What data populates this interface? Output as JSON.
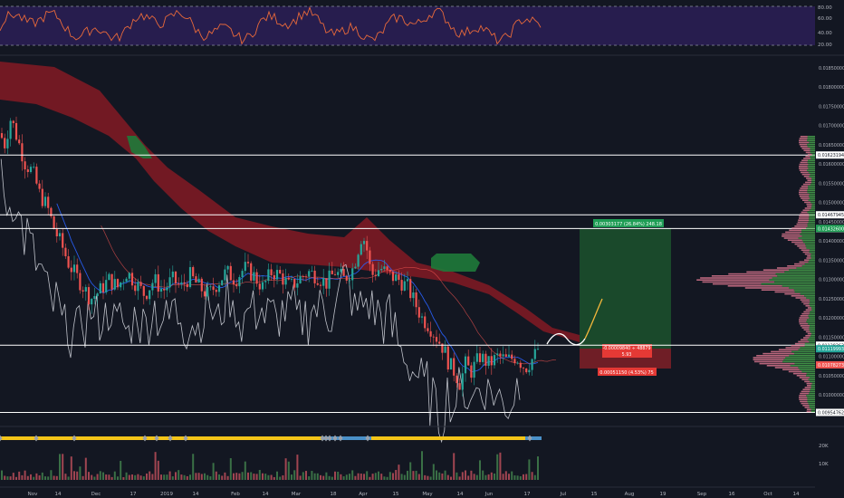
{
  "colors": {
    "background": "#131722",
    "grid": "#1e2230",
    "candle_up": "#26a69a",
    "candle_down": "#ef5350",
    "cloud_bear": "#8b1a24",
    "cloud_bull": "#1f7a3a",
    "lagging_line": "#d1d4dc",
    "base_line": "#2962ff",
    "rsi_line": "#e8693a",
    "rsi_band": "#2c1f56",
    "level_line": "#ffffff",
    "profile_up": "#4caf50",
    "profile_down": "#e37b93",
    "forecast_curve": "#ffffff",
    "forecast_arrow_up": "#f5b73b",
    "target_zone": "#1c4f2c",
    "stop_zone": "#7a1f27",
    "strip_yellow": "#f5c518",
    "strip_blue": "#4a90c8"
  },
  "rsi_panel": {
    "ticks": [
      "80.00",
      "60.00",
      "40.00",
      "20.00"
    ],
    "band_upper": 80,
    "band_lower": 20
  },
  "main_panel": {
    "y_ticks": [
      "0.01850000",
      "0.01800000",
      "0.01750000",
      "0.01700000",
      "0.01650000",
      "0.01600000",
      "0.01550000",
      "0.01500000",
      "0.01450000",
      "0.01400000",
      "0.01350000",
      "0.01300000",
      "0.01250000",
      "0.01200000",
      "0.01150000",
      "0.01100000",
      "0.01050000",
      "0.01000000"
    ],
    "levels": [
      {
        "label": "0.01623194",
        "value": 0.01623194
      },
      {
        "label": "0.01467945",
        "value": 0.01467945
      },
      {
        "label": "0.01432221",
        "value": 0.01432221
      },
      {
        "label": "0.01129421",
        "value": 0.01129421
      },
      {
        "label": "0.00954762",
        "value": 0.00954762
      }
    ],
    "price_tags": [
      {
        "label": "0.01432600",
        "value": 0.014326,
        "color": "#1f9d55"
      },
      {
        "label": "0.01128363",
        "value": 0.01128363,
        "color": "#ffffff"
      },
      {
        "label": "0.01119993",
        "value": 0.01119993,
        "color": "#26a69a"
      },
      {
        "label": "0.01078273",
        "value": 0.01078273,
        "color": "#ef5350"
      }
    ],
    "position_labels": {
      "target": "0.00303177 (26.84%) 248.18",
      "entry_line1": "-0.00009840 ÷ 48879",
      "entry_line2": "5.93",
      "stop": "0.00051150 (4.53%) 75"
    }
  },
  "volume_panel": {
    "ticks": [
      "20K",
      "10K"
    ]
  },
  "x_ticks": [
    "Nov",
    "14",
    "Dec",
    "17",
    "2019",
    "14",
    "Feb",
    "14",
    "Mar",
    "18",
    "Apr",
    "15",
    "May",
    "14",
    "Jun",
    "17",
    "Jul",
    "15",
    "Aug",
    "19",
    "Sep",
    "16",
    "Oct",
    "14"
  ],
  "chart_data": {
    "type": "candlestick",
    "symbol": "",
    "y_range": [
      0.0093,
      0.0188
    ],
    "rsi_range": [
      10,
      85
    ],
    "support_resistance": [
      0.01623194,
      0.01467945,
      0.01432221,
      0.01129421,
      0.00954762
    ],
    "long_position": {
      "entry": 0.01128363,
      "target": 0.014326,
      "stop": 0.01078273
    },
    "close_path": [
      [
        0,
        0.0168
      ],
      [
        5,
        0.0165
      ],
      [
        12,
        0.0172
      ],
      [
        20,
        0.0166
      ],
      [
        28,
        0.016
      ],
      [
        36,
        0.0158
      ],
      [
        44,
        0.0152
      ],
      [
        52,
        0.0149
      ],
      [
        60,
        0.0143
      ],
      [
        68,
        0.0139
      ],
      [
        76,
        0.0134
      ],
      [
        84,
        0.0131
      ],
      [
        92,
        0.0128
      ],
      [
        100,
        0.0125
      ],
      [
        110,
        0.0127
      ],
      [
        120,
        0.013
      ],
      [
        130,
        0.0128
      ],
      [
        140,
        0.0132
      ],
      [
        150,
        0.0129
      ],
      [
        160,
        0.0126
      ],
      [
        170,
        0.013
      ],
      [
        180,
        0.0127
      ],
      [
        190,
        0.013
      ],
      [
        200,
        0.0128
      ],
      [
        210,
        0.0131
      ],
      [
        220,
        0.0128
      ],
      [
        230,
        0.0126
      ],
      [
        240,
        0.0129
      ],
      [
        250,
        0.0132
      ],
      [
        260,
        0.013
      ],
      [
        270,
        0.0133
      ],
      [
        280,
        0.0131
      ],
      [
        290,
        0.0128
      ],
      [
        300,
        0.0132
      ],
      [
        310,
        0.0131
      ],
      [
        320,
        0.0128
      ],
      [
        330,
        0.013
      ],
      [
        340,
        0.0132
      ],
      [
        350,
        0.0131
      ],
      [
        360,
        0.0129
      ],
      [
        370,
        0.0132
      ],
      [
        380,
        0.013
      ],
      [
        390,
        0.0133
      ],
      [
        400,
        0.0142
      ],
      [
        405,
        0.0138
      ],
      [
        410,
        0.0131
      ],
      [
        420,
        0.0133
      ],
      [
        430,
        0.0131
      ],
      [
        440,
        0.013
      ],
      [
        450,
        0.0128
      ],
      [
        458,
        0.0124
      ],
      [
        466,
        0.012
      ],
      [
        474,
        0.0118
      ],
      [
        482,
        0.0115
      ],
      [
        490,
        0.0112
      ],
      [
        496,
        0.0108
      ],
      [
        502,
        0.0106
      ],
      [
        508,
        0.0103
      ],
      [
        514,
        0.0108
      ],
      [
        520,
        0.0106
      ],
      [
        530,
        0.011
      ],
      [
        540,
        0.0108
      ],
      [
        550,
        0.011
      ],
      [
        560,
        0.0109
      ],
      [
        570,
        0.011
      ],
      [
        580,
        0.0107
      ],
      [
        590,
        0.011
      ],
      [
        596,
        0.0113
      ]
    ]
  }
}
